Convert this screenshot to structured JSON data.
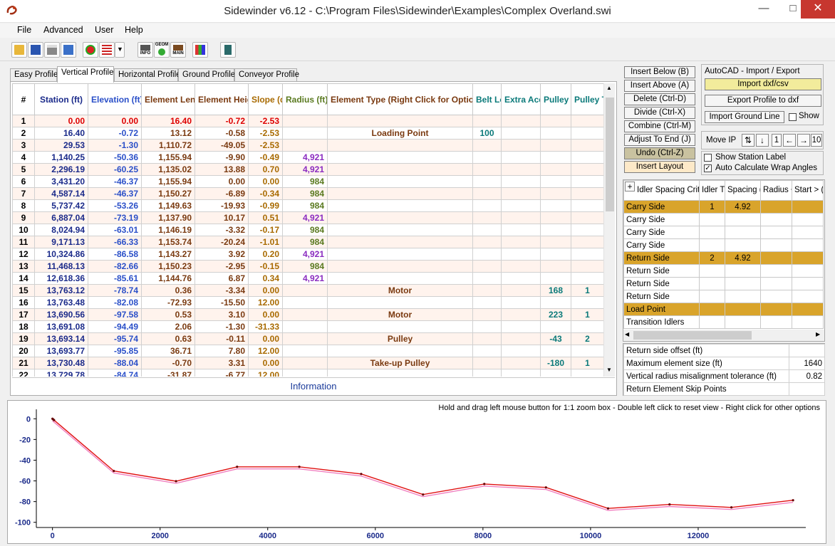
{
  "window": {
    "title": "Sidewinder v6.12 - C:\\Program Files\\Sidewinder\\Examples\\Complex Overland.swi"
  },
  "menu": {
    "items": [
      "File",
      "Advanced",
      "User",
      "Help"
    ]
  },
  "toolbar": {
    "icons": [
      "open-folder-icon",
      "save-icon",
      "print-icon",
      "edit-icon",
      "color-icon",
      "flag-icon",
      "dropdown-icon",
      "info-icon",
      "geom-icon",
      "main-icon",
      "report-icon",
      "calculator-icon"
    ],
    "info_label": "INFO",
    "geom_label": "GEOM",
    "main_label": "MAIN"
  },
  "tabs": [
    {
      "label": "Easy Profile"
    },
    {
      "label": "Vertical Profile"
    },
    {
      "label": "Horizontal Profile"
    },
    {
      "label": "Ground Profile"
    },
    {
      "label": "Conveyor Profile"
    }
  ],
  "grid": {
    "headers": [
      {
        "text": "#",
        "color": "#000000"
      },
      {
        "text": "Station (ft)",
        "color": "#1a2a8a"
      },
      {
        "text": "Elevation (ft)",
        "color": "#2a4fc8"
      },
      {
        "text": "Element Length (ft)",
        "color": "#7a3a10"
      },
      {
        "text": "Element Height (ft)",
        "color": "#7a3a10"
      },
      {
        "text": "Slope (deg)",
        "color": "#a86a00"
      },
      {
        "text": "Radius (ft)",
        "color": "#5a7a20"
      },
      {
        "text": "Element Type (Right Click for Options)",
        "color": "#7a3a10"
      },
      {
        "text": "Belt Load %",
        "color": "#0b7a7a"
      },
      {
        "text": "Extra Acc Type",
        "color": "#0b7a7a"
      },
      {
        "text": "Pulley Wrap (deg)",
        "color": "#0b7a7a"
      },
      {
        "text": "Pulley Type ID",
        "color": "#0b7a7a"
      }
    ],
    "rows": [
      [
        "1",
        "0.00",
        "0.00",
        "16.40",
        "-0.72",
        "-2.53",
        "",
        "",
        "",
        "",
        "",
        ""
      ],
      [
        "2",
        "16.40",
        "-0.72",
        "13.12",
        "-0.58",
        "-2.53",
        "",
        "Loading Point",
        "100",
        "",
        "",
        ""
      ],
      [
        "3",
        "29.53",
        "-1.30",
        "1,110.72",
        "-49.05",
        "-2.53",
        "",
        "",
        "",
        "",
        "",
        ""
      ],
      [
        "4",
        "1,140.25",
        "-50.36",
        "1,155.94",
        "-9.90",
        "-0.49",
        "4,921",
        "",
        "",
        "",
        "",
        ""
      ],
      [
        "5",
        "2,296.19",
        "-60.25",
        "1,135.02",
        "13.88",
        "0.70",
        "4,921",
        "",
        "",
        "",
        "",
        ""
      ],
      [
        "6",
        "3,431.20",
        "-46.37",
        "1,155.94",
        "0.00",
        "0.00",
        "984",
        "",
        "",
        "",
        "",
        ""
      ],
      [
        "7",
        "4,587.14",
        "-46.37",
        "1,150.27",
        "-6.89",
        "-0.34",
        "984",
        "",
        "",
        "",
        "",
        ""
      ],
      [
        "8",
        "5,737.42",
        "-53.26",
        "1,149.63",
        "-19.93",
        "-0.99",
        "984",
        "",
        "",
        "",
        "",
        ""
      ],
      [
        "9",
        "6,887.04",
        "-73.19",
        "1,137.90",
        "10.17",
        "0.51",
        "4,921",
        "",
        "",
        "",
        "",
        ""
      ],
      [
        "10",
        "8,024.94",
        "-63.01",
        "1,146.19",
        "-3.32",
        "-0.17",
        "984",
        "",
        "",
        "",
        "",
        ""
      ],
      [
        "11",
        "9,171.13",
        "-66.33",
        "1,153.74",
        "-20.24",
        "-1.01",
        "984",
        "",
        "",
        "",
        "",
        ""
      ],
      [
        "12",
        "10,324.86",
        "-86.58",
        "1,143.27",
        "3.92",
        "0.20",
        "4,921",
        "",
        "",
        "",
        "",
        ""
      ],
      [
        "13",
        "11,468.13",
        "-82.66",
        "1,150.23",
        "-2.95",
        "-0.15",
        "984",
        "",
        "",
        "",
        "",
        ""
      ],
      [
        "14",
        "12,618.36",
        "-85.61",
        "1,144.76",
        "6.87",
        "0.34",
        "4,921",
        "",
        "",
        "",
        "",
        ""
      ],
      [
        "15",
        "13,763.12",
        "-78.74",
        "0.36",
        "-3.34",
        "0.00",
        "",
        "Motor",
        "",
        "",
        "168",
        "1"
      ],
      [
        "16",
        "13,763.48",
        "-82.08",
        "-72.93",
        "-15.50",
        "12.00",
        "",
        "",
        "",
        "",
        "",
        ""
      ],
      [
        "17",
        "13,690.56",
        "-97.58",
        "0.53",
        "3.10",
        "0.00",
        "",
        "Motor",
        "",
        "",
        "223",
        "1"
      ],
      [
        "18",
        "13,691.08",
        "-94.49",
        "2.06",
        "-1.30",
        "-31.33",
        "",
        "",
        "",
        "",
        "",
        ""
      ],
      [
        "19",
        "13,693.14",
        "-95.74",
        "0.63",
        "-0.11",
        "0.00",
        "",
        "Pulley",
        "",
        "",
        "-43",
        "2"
      ],
      [
        "20",
        "13,693.77",
        "-95.85",
        "36.71",
        "7.80",
        "12.00",
        "",
        "",
        "",
        "",
        "",
        ""
      ],
      [
        "21",
        "13,730.48",
        "-88.04",
        "-0.70",
        "3.31",
        "0.00",
        "",
        "Take-up Pulley",
        "",
        "",
        "-180",
        "1"
      ],
      [
        "22",
        "13,729.78",
        "-84.74",
        "-31.87",
        "-6.77",
        "12.00",
        "",
        "",
        "",
        "",
        "",
        ""
      ]
    ],
    "info_label": "Information"
  },
  "right_buttons": {
    "insert_below": "Insert Below (B)",
    "insert_above": "Insert Above (A)",
    "delete": "Delete (Ctrl-D)",
    "divide": "Divide (Ctrl-X)",
    "combine": "Combine (Ctrl-M)",
    "adjust_to_end": "Adjust To End (J)",
    "undo": "Undo (Ctrl-Z)",
    "insert_layout": "Insert Layout"
  },
  "autocad": {
    "title": "AutoCAD - Import / Export",
    "import_dxf": "Import dxf/csv",
    "export_profile": "Export Profile to dxf",
    "import_ground": "Import Ground Line",
    "show_label": "Show",
    "show_checked": false
  },
  "move_ip": {
    "label": "Move IP",
    "value_left": "1",
    "value_right": "10"
  },
  "options": {
    "show_station_label": "Show Station Label",
    "show_station_checked": false,
    "auto_calc_wrap": "Auto Calculate Wrap Angles",
    "auto_calc_checked": true
  },
  "idler": {
    "plus": "+",
    "headers": [
      "Idler Spacing Criteria",
      "Idler Type",
      "Spacing (ft)",
      "Radius < (ft)",
      "Start > (ft)"
    ],
    "rows": [
      {
        "cells": [
          "Carry Side",
          "1",
          "4.92",
          "",
          ""
        ],
        "highlight": true
      },
      {
        "cells": [
          "Carry Side",
          "",
          "",
          "",
          ""
        ],
        "highlight": false
      },
      {
        "cells": [
          "Carry Side",
          "",
          "",
          "",
          ""
        ],
        "highlight": false
      },
      {
        "cells": [
          "Carry Side",
          "",
          "",
          "",
          ""
        ],
        "highlight": false
      },
      {
        "cells": [
          "Return Side",
          "2",
          "4.92",
          "",
          ""
        ],
        "highlight": true
      },
      {
        "cells": [
          "Return Side",
          "",
          "",
          "",
          ""
        ],
        "highlight": false
      },
      {
        "cells": [
          "Return Side",
          "",
          "",
          "",
          ""
        ],
        "highlight": false
      },
      {
        "cells": [
          "Return Side",
          "",
          "",
          "",
          ""
        ],
        "highlight": false
      },
      {
        "cells": [
          "Load Point",
          "",
          "",
          "",
          ""
        ],
        "highlight": true
      },
      {
        "cells": [
          "Transition Idlers",
          "",
          "",
          "",
          ""
        ],
        "highlight": false
      }
    ]
  },
  "params": [
    {
      "label": "Return side offset (ft)",
      "value": ""
    },
    {
      "label": "Maximum element size (ft)",
      "value": "1640"
    },
    {
      "label": "Vertical radius misalignment tolerance (ft)",
      "value": "0.82"
    },
    {
      "label": "Return Element Skip Points",
      "value": ""
    }
  ],
  "plot": {
    "hint": "Hold and drag left mouse button for 1:1 zoom box - Double left click to reset view - Right click for other options"
  },
  "colors": {
    "highlight": "#d9a42b",
    "profile_line": "#e01010",
    "return_line": "#f080c0"
  },
  "chart_data": {
    "type": "line",
    "title": "",
    "xlabel": "",
    "ylabel": "",
    "xlim": [
      -300,
      14000
    ],
    "ylim": [
      -105,
      5
    ],
    "xticks": [
      "0",
      "2000",
      "4000",
      "6000",
      "8000",
      "10000",
      "12000"
    ],
    "yticks": [
      "0",
      "-20",
      "-40",
      "-60",
      "-80",
      "-100"
    ],
    "grid": false,
    "series": [
      {
        "x": [
          0,
          16.4,
          29.5,
          1140,
          2296,
          3431,
          4587,
          5737,
          6887,
          8025,
          9171,
          10325,
          11468,
          12618,
          13763
        ],
        "y": [
          0,
          -0.7,
          -1.3,
          -50.4,
          -60.3,
          -46.4,
          -46.4,
          -53.3,
          -73.2,
          -63.0,
          -66.3,
          -86.6,
          -82.7,
          -85.6,
          -78.7
        ]
      },
      {
        "x": [
          0,
          1140,
          2296,
          3431,
          4587,
          5737,
          6887,
          8025,
          9171,
          10325,
          11468,
          12618,
          13763
        ],
        "y": [
          -2,
          -52.4,
          -62.3,
          -48.4,
          -48.4,
          -55.3,
          -75.2,
          -65.0,
          -68.3,
          -88.6,
          -84.7,
          -87.6,
          -80.7
        ]
      }
    ]
  }
}
